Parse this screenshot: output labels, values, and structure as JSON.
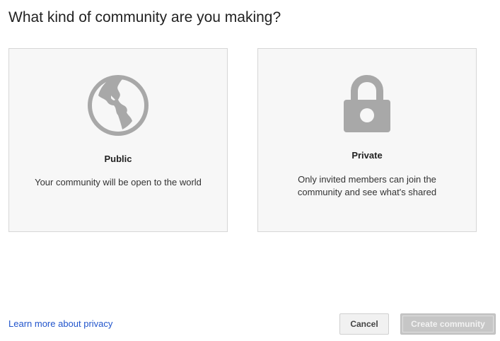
{
  "dialog": {
    "title": "What kind of community are you making?"
  },
  "options": {
    "public": {
      "icon": "globe-icon",
      "title": "Public",
      "description": "Your community will be open to the world"
    },
    "private": {
      "icon": "lock-icon",
      "title": "Private",
      "description": "Only invited members can join the community and see what's shared"
    }
  },
  "footer": {
    "learn_more": "Learn more about privacy",
    "cancel_label": "Cancel",
    "create_label": "Create community"
  },
  "colors": {
    "icon_gray": "#a8a8a8",
    "card_bg": "#f7f7f7",
    "link": "#2255cc",
    "disabled_button": "#c6c6c6"
  }
}
